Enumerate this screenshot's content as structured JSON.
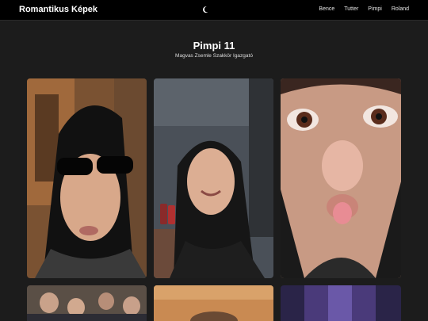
{
  "header": {
    "brand": "Romantikus Képek",
    "theme_icon": "moon-icon",
    "nav": [
      "Bence",
      "Tutter",
      "Pimpi",
      "Roland"
    ]
  },
  "page": {
    "title": "Pimpi 11",
    "subtitle": "Magvas Zsemle Szakkör Igazgató"
  },
  "colors": {
    "topbar": "#000000",
    "background": "#1c1c1c"
  }
}
